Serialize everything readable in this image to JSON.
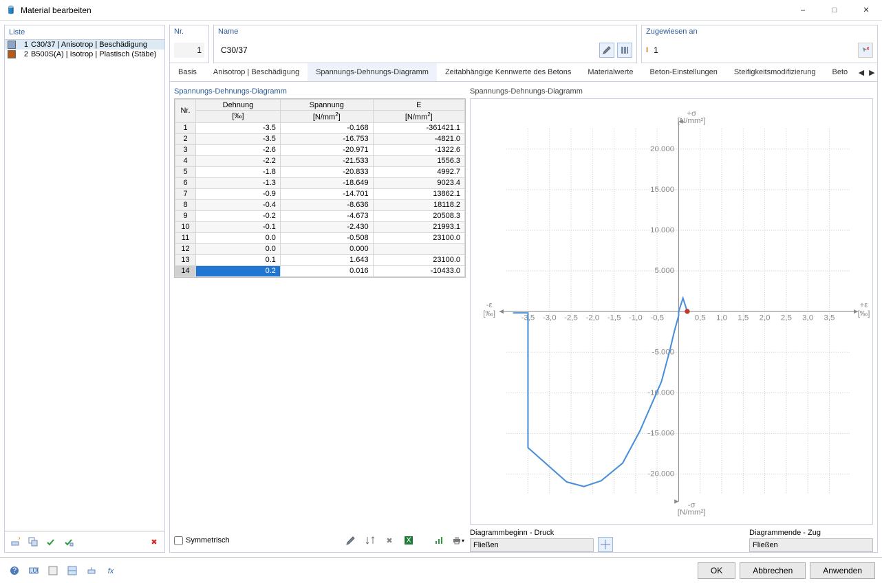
{
  "window": {
    "title": "Material bearbeiten"
  },
  "list": {
    "header": "Liste",
    "items": [
      {
        "num": "1",
        "label": "C30/37 | Anisotrop | Beschädigung",
        "swatch": "#8fa5c7",
        "selected": true
      },
      {
        "num": "2",
        "label": "B500S(A) | Isotrop | Plastisch (Stäbe)",
        "swatch": "#b55a1a",
        "selected": false
      }
    ],
    "toolbar_delete_title": "Löschen"
  },
  "fields": {
    "nr_label": "Nr.",
    "nr_value": "1",
    "name_label": "Name",
    "name_value": "C30/37",
    "assign_label": "Zugewiesen an",
    "assign_value": "1"
  },
  "tabs": {
    "items": [
      "Basis",
      "Anisotrop | Beschädigung",
      "Spannungs-Dehnungs-Diagramm",
      "Zeitabhängige Kennwerte des Betons",
      "Materialwerte",
      "Beton-Einstellungen",
      "Steifigkeitsmodifizierung",
      "Beto"
    ],
    "active_index": 2
  },
  "table": {
    "section_title": "Spannungs-Dehnungs-Diagramm",
    "headers": {
      "nr": "Nr.",
      "strain": "Dehnung",
      "strain_u": "[‰]",
      "stress": "Spannung",
      "stress_u": "[N/mm²]",
      "e": "E",
      "e_u": "[N/mm²]"
    },
    "rows": [
      [
        "1",
        "-3.5",
        "-0.168",
        "-361421.1"
      ],
      [
        "2",
        "-3.5",
        "-16.753",
        "-4821.0"
      ],
      [
        "3",
        "-2.6",
        "-20.971",
        "-1322.6"
      ],
      [
        "4",
        "-2.2",
        "-21.533",
        "1556.3"
      ],
      [
        "5",
        "-1.8",
        "-20.833",
        "4992.7"
      ],
      [
        "6",
        "-1.3",
        "-18.649",
        "9023.4"
      ],
      [
        "7",
        "-0.9",
        "-14.701",
        "13862.1"
      ],
      [
        "8",
        "-0.4",
        "-8.636",
        "18118.2"
      ],
      [
        "9",
        "-0.2",
        "-4.673",
        "20508.3"
      ],
      [
        "10",
        "-0.1",
        "-2.430",
        "21993.1"
      ],
      [
        "11",
        "0.0",
        "-0.508",
        "23100.0"
      ],
      [
        "12",
        "0.0",
        "0.000",
        ""
      ],
      [
        "13",
        "0.1",
        "1.643",
        "23100.0"
      ],
      [
        "14",
        "0.2",
        "0.016",
        "-10433.0"
      ]
    ],
    "selected_row": 13,
    "sym_label": "Symmetrisch"
  },
  "chart": {
    "section_title": "Spannungs-Dehnungs-Diagramm",
    "xlabel_neg": "-ε",
    "xlabel_pos": "+ε",
    "xunit": "[‰]",
    "ylabel_pos": "+σ",
    "ylabel_neg": "-σ",
    "yunit": "[N/mm²]",
    "begin_label": "Diagrammbeginn - Druck",
    "begin_value": "Fließen",
    "end_label": "Diagrammende - Zug",
    "end_value": "Fließen"
  },
  "chart_data": {
    "type": "line",
    "x": [
      -3.5,
      -3.5,
      -2.6,
      -2.2,
      -1.8,
      -1.3,
      -0.9,
      -0.4,
      -0.2,
      -0.1,
      0.0,
      0.0,
      0.1,
      0.2
    ],
    "y": [
      -0.168,
      -16.753,
      -20.971,
      -21.533,
      -20.833,
      -18.649,
      -14.701,
      -8.636,
      -4.673,
      -2.43,
      -0.508,
      0.0,
      1.643,
      0.016
    ],
    "xlabel": "ε [‰]",
    "ylabel": "σ [N/mm²]",
    "xlim": [
      -4.0,
      4.0
    ],
    "ylim": [
      -22.5,
      22.5
    ],
    "xticks": [
      -3.5,
      -3.0,
      -2.5,
      -2.0,
      -1.5,
      -1.0,
      -0.5,
      0.5,
      1.0,
      1.5,
      2.0,
      2.5,
      3.0,
      3.5
    ],
    "yticks": [
      -20000,
      -15000,
      -10000,
      -5000,
      5000,
      10000,
      15000,
      20000
    ],
    "ytick_labels": [
      "-20.000",
      "-15.000",
      "-10.000",
      "-5.000",
      "5.000",
      "10.000",
      "15.000",
      "20.000"
    ],
    "highlight_point": {
      "x": 0.2,
      "y": 0.016
    }
  },
  "footer": {
    "ok": "OK",
    "cancel": "Abbrechen",
    "apply": "Anwenden"
  }
}
